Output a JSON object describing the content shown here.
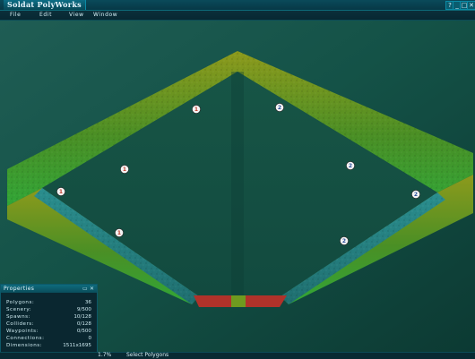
{
  "app": {
    "title": "Soldat PolyWorks",
    "window_buttons": [
      "?",
      "_",
      "□",
      "✕"
    ]
  },
  "menu": {
    "items": [
      "File",
      "Edit",
      "View",
      "Window"
    ]
  },
  "markers": [
    {
      "team": "1",
      "color": "#c23a2a"
    },
    {
      "team": "1",
      "color": "#c23a2a"
    },
    {
      "team": "1",
      "color": "#c23a2a"
    },
    {
      "team": "1",
      "color": "#c23a2a"
    },
    {
      "team": "2",
      "color": "#2a4f9a"
    },
    {
      "team": "2",
      "color": "#2a4f9a"
    },
    {
      "team": "2",
      "color": "#2a4f9a"
    },
    {
      "team": "2",
      "color": "#2a4f9a"
    }
  ],
  "properties": {
    "title": "Properties",
    "controls": [
      "▭",
      "✕"
    ],
    "rows": [
      {
        "label": "Polygons:",
        "value": "36"
      },
      {
        "label": "Scenery:",
        "value": "9/500"
      },
      {
        "label": "Spawns:",
        "value": "10/128"
      },
      {
        "label": "Colliders:",
        "value": "0/128"
      },
      {
        "label": "Waypoints:",
        "value": "0/500"
      },
      {
        "label": "Connections:",
        "value": "0"
      },
      {
        "label": "Dimensions:",
        "value": "1511x1695"
      }
    ]
  },
  "status": {
    "zoom": "1.7%",
    "mode": "Select Polygons"
  },
  "colors": {
    "background": "#0f3f34",
    "wall_top": "#8a9b1f",
    "wall_bottom": "#35a33a",
    "floor_edge": "#2c8f8f",
    "pit_red": "#b0322a"
  }
}
